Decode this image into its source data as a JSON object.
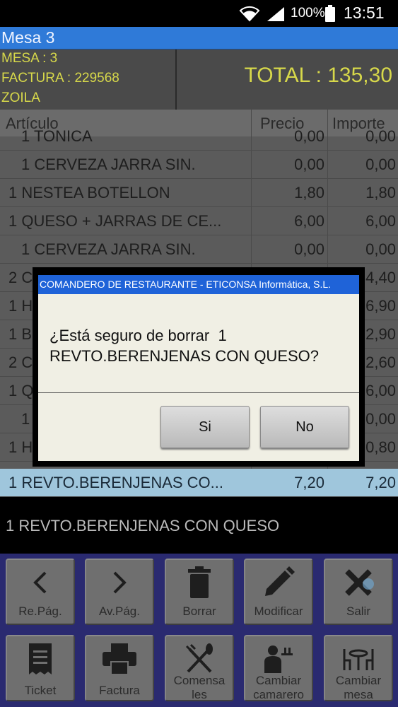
{
  "status_bar": {
    "battery_percent": "100%",
    "time": "13:51",
    "icons": [
      "wifi-icon",
      "signal-icon",
      "battery-icon"
    ]
  },
  "window": {
    "title": "Mesa 3"
  },
  "header": {
    "mesa": "MESA : 3",
    "factura": "FACTURA : 229568",
    "camarero": "ZOILA",
    "total": "TOTAL : 135,30"
  },
  "table": {
    "columns": [
      "Artículo",
      "Precio",
      "Importe"
    ],
    "rows": [
      {
        "articulo": "1 TONICA",
        "precio": "0,00",
        "importe": "0,00",
        "sub": true
      },
      {
        "articulo": "1 CERVEZA JARRA SIN.",
        "precio": "0,00",
        "importe": "0,00",
        "sub": true
      },
      {
        "articulo": "1 NESTEA BOTELLON",
        "precio": "1,80",
        "importe": "1,80",
        "sub": false
      },
      {
        "articulo": "1 QUESO + JARRAS DE CE...",
        "precio": "6,00",
        "importe": "6,00",
        "sub": false
      },
      {
        "articulo": "1 CERVEZA JARRA SIN.",
        "precio": "0,00",
        "importe": "0,00",
        "sub": true
      },
      {
        "articulo": "2 C",
        "precio": "",
        "importe": "4,40",
        "sub": false
      },
      {
        "articulo": "1 H",
        "precio": "",
        "importe": "6,90",
        "sub": false
      },
      {
        "articulo": "1 B",
        "precio": "",
        "importe": "2,90",
        "sub": false
      },
      {
        "articulo": "2 C",
        "precio": "",
        "importe": "2,60",
        "sub": false
      },
      {
        "articulo": "1 Q",
        "precio": "",
        "importe": "6,00",
        "sub": false
      },
      {
        "articulo": "1",
        "precio": "",
        "importe": "0,00",
        "sub": true
      },
      {
        "articulo": "1 H",
        "precio": "",
        "importe": "0,80",
        "sub": false
      },
      {
        "articulo": "1 REVTO.BERENJENAS CO...",
        "precio": "7,20",
        "importe": "7,20",
        "sub": false,
        "selected": true
      }
    ]
  },
  "detail_line": "1 REVTO.BERENJENAS CON QUESO",
  "toolbar": {
    "row1": [
      {
        "label": "Re.Pág.",
        "icon": "chevron-left-icon"
      },
      {
        "label": "Av.Pág.",
        "icon": "chevron-right-icon"
      },
      {
        "label": "Borrar",
        "icon": "trash-icon"
      },
      {
        "label": "Modificar",
        "icon": "pencil-icon"
      },
      {
        "label": "Salir",
        "icon": "close-icon"
      }
    ],
    "row2": [
      {
        "label": "Ticket",
        "icon": "receipt-icon"
      },
      {
        "label": "Factura",
        "icon": "printer-icon"
      },
      {
        "label1": "Comensa",
        "label2": "les",
        "icon": "fork-knife-icon"
      },
      {
        "label1": "Cambiar",
        "label2": "camarero",
        "icon": "waiter-icon"
      },
      {
        "label1": "Cambiar",
        "label2": "mesa",
        "icon": "table-chairs-icon"
      }
    ]
  },
  "dialog": {
    "title": "COMANDERO DE RESTAURANTE - ETICONSA Informática, S.L.",
    "message_line1": "¿Está seguro de borrar  1",
    "message_line2": "REVTO.BERENJENAS CON QUESO?",
    "yes_label": "Si",
    "no_label": "No"
  },
  "colors": {
    "title_bar": "#2f7ad8",
    "header_text": "#d7d84a",
    "selected_row": "#9fc6dc",
    "toolbar_bg": "#2a2a70",
    "dialog_title": "#1f63d8"
  }
}
